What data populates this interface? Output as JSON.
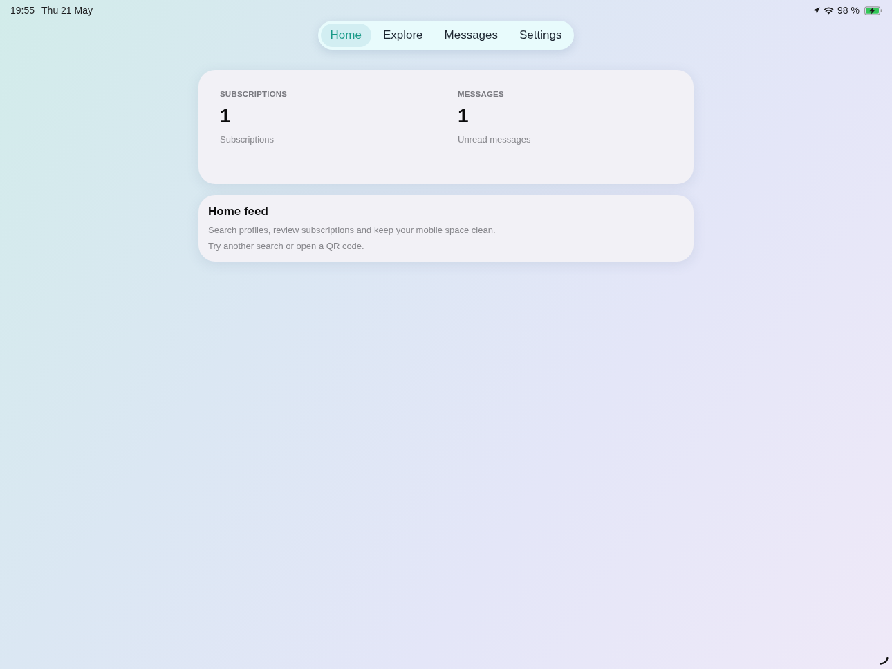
{
  "status_bar": {
    "time": "19:55",
    "date": "Thu 21 May",
    "battery_percent": "98 %",
    "charging": true
  },
  "tabs": [
    {
      "label": "Home",
      "selected": true
    },
    {
      "label": "Explore",
      "selected": false
    },
    {
      "label": "Messages",
      "selected": false
    },
    {
      "label": "Settings",
      "selected": false
    }
  ],
  "stats": [
    {
      "heading": "SUBSCRIPTIONS",
      "value": "1",
      "caption": "Subscriptions"
    },
    {
      "heading": "MESSAGES",
      "value": "1",
      "caption": "Unread messages"
    }
  ],
  "feed": {
    "title": "Home feed",
    "lines": [
      "Search profiles, review subscriptions and keep your mobile space clean.",
      "Try another search or open a QR code."
    ]
  }
}
